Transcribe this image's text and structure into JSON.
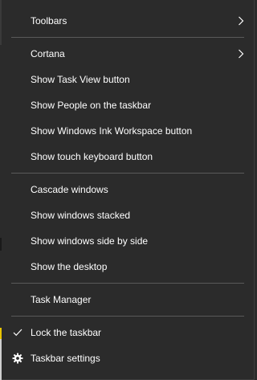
{
  "menu": {
    "groups": [
      {
        "items": [
          {
            "label": "Toolbars",
            "submenu": true
          }
        ]
      },
      {
        "items": [
          {
            "label": "Cortana",
            "submenu": true
          },
          {
            "label": "Show Task View button"
          },
          {
            "label": "Show People on the taskbar"
          },
          {
            "label": "Show Windows Ink Workspace button"
          },
          {
            "label": "Show touch keyboard button"
          }
        ]
      },
      {
        "items": [
          {
            "label": "Cascade windows"
          },
          {
            "label": "Show windows stacked"
          },
          {
            "label": "Show windows side by side"
          },
          {
            "label": "Show the desktop"
          }
        ]
      },
      {
        "items": [
          {
            "label": "Task Manager"
          }
        ]
      },
      {
        "items": [
          {
            "label": "Lock the taskbar",
            "icon": "checkmark-icon",
            "checked": true
          },
          {
            "label": "Taskbar settings",
            "icon": "gear-icon"
          }
        ]
      }
    ]
  },
  "colors": {
    "menu_background": "#2b2b2b",
    "text": "#ffffff",
    "separator": "#5a5a5a"
  }
}
